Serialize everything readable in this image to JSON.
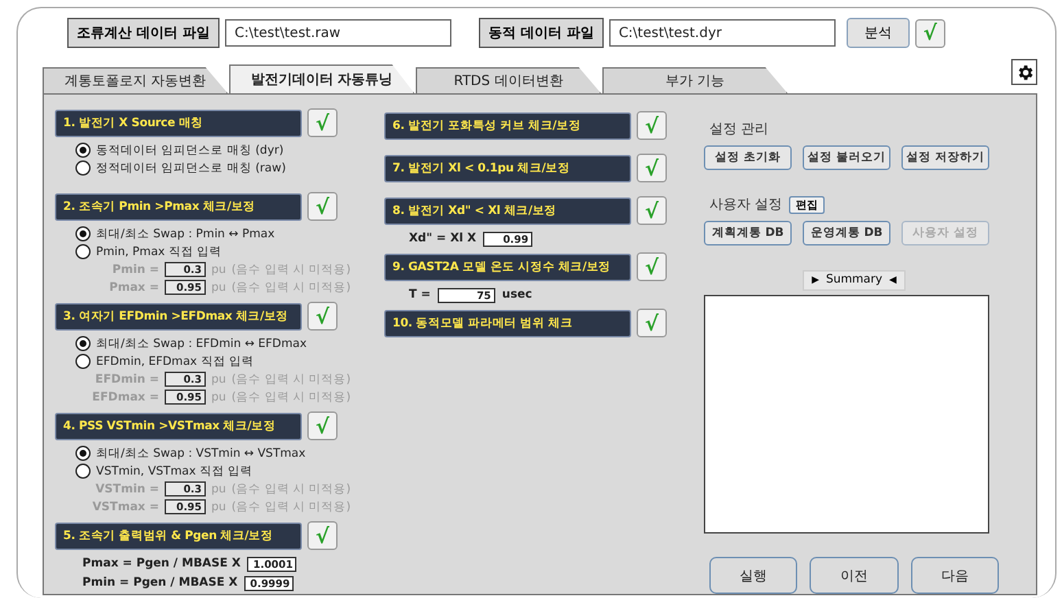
{
  "top_bar": {
    "flow_label": "조류계산 데이터 파일",
    "flow_path": "C:\\test\\test.raw",
    "dyn_label": "동적 데이터 파일",
    "dyn_path": "C:\\test\\test.dyr",
    "analyze_button": "분석",
    "check": "√"
  },
  "tabs": [
    {
      "label": "계통토폴로지 자동변환",
      "selected": false
    },
    {
      "label": "발전기데이터 자동튜닝",
      "selected": true
    },
    {
      "label": "RTDS 데이터변환",
      "selected": false
    },
    {
      "label": "부가 기능",
      "selected": false
    }
  ],
  "left_sections": [
    {
      "title": "1. 발전기 X Source 매칭",
      "check": "√",
      "rows": [
        {
          "kind": "radio",
          "label": "동적데이터 임피던스로 매칭 (dyr)",
          "selected": true
        },
        {
          "kind": "radio",
          "label": "정적데이터 임피던스로 매칭 (raw)",
          "selected": false
        }
      ]
    },
    {
      "title": "2. 조속기 Pmin >Pmax 체크/보정",
      "check": "√",
      "rows": [
        {
          "kind": "radio",
          "label": "최대/최소 Swap : Pmin ↔ Pmax",
          "selected": true
        },
        {
          "kind": "radio",
          "label": "Pmin, Pmax 직접 입력",
          "selected": false
        },
        {
          "kind": "param",
          "label": "Pmin =",
          "value": "0.3",
          "unit": "pu",
          "note": "(음수 입력 시 미적용)",
          "disabled": true
        },
        {
          "kind": "param",
          "label": "Pmax =",
          "value": "0.95",
          "unit": "pu",
          "note": "(음수 입력 시 미적용)",
          "disabled": true
        }
      ]
    },
    {
      "title": "3. 여자기 EFDmin >EFDmax 체크/보정",
      "check": "√",
      "rows": [
        {
          "kind": "radio",
          "label": "최대/최소 Swap : EFDmin ↔ EFDmax",
          "selected": true
        },
        {
          "kind": "radio",
          "label": "EFDmin, EFDmax 직접 입력",
          "selected": false
        },
        {
          "kind": "param",
          "label": "EFDmin =",
          "value": "0.3",
          "unit": "pu",
          "note": "(음수 입력 시 미적용)",
          "disabled": true
        },
        {
          "kind": "param",
          "label": "EFDmax =",
          "value": "0.95",
          "unit": "pu",
          "note": "(음수 입력 시 미적용)",
          "disabled": true
        }
      ]
    },
    {
      "title": "4. PSS VSTmin >VSTmax 체크/보정",
      "check": "√",
      "rows": [
        {
          "kind": "radio",
          "label": "최대/최소 Swap : VSTmin ↔ VSTmax",
          "selected": true
        },
        {
          "kind": "radio",
          "label": "VSTmin, VSTmax 직접 입력",
          "selected": false
        },
        {
          "kind": "param",
          "label": "VSTmin =",
          "value": "0.3",
          "unit": "pu",
          "note": "(음수 입력 시 미적용)",
          "disabled": true
        },
        {
          "kind": "param",
          "label": "VSTmax =",
          "value": "0.95",
          "unit": "pu",
          "note": "(음수 입력 시 미적용)",
          "disabled": true
        }
      ]
    },
    {
      "title": "5. 조속기 출력범위 & Pgen 체크/보정",
      "check": "√",
      "rows": [
        {
          "kind": "formula",
          "label": "Pmax = Pgen / MBASE  X",
          "value": "1.0001"
        },
        {
          "kind": "formula",
          "label": "Pmin = Pgen / MBASE  X",
          "value": "0.9999"
        }
      ]
    }
  ],
  "middle_sections": [
    {
      "title": "6. 발전기 포화특성 커브 체크/보정",
      "check": "√"
    },
    {
      "title": "7. 발전기 Xl  < 0.1pu 체크/보정",
      "check": "√"
    },
    {
      "title": "8. 발전기 Xd\"  < Xl 체크/보정",
      "check": "√",
      "rows": [
        {
          "kind": "formula",
          "label": "Xd\" = Xl X",
          "value": "0.99"
        }
      ]
    },
    {
      "title": "9. GAST2A 모델 온도 시정수 체크/보정",
      "check": "√",
      "rows": [
        {
          "kind": "formula",
          "label": "T =",
          "value": "75",
          "unit": "usec"
        }
      ]
    },
    {
      "title": "10. 동적모델 파라메터 범위 체크",
      "check": "√"
    }
  ],
  "settings": {
    "title": "설정 관리",
    "buttons": [
      {
        "label": "설정 초기화",
        "disabled": false
      },
      {
        "label": "설정 불러오기",
        "disabled": false
      },
      {
        "label": "설정 저장하기",
        "disabled": false
      }
    ]
  },
  "user_settings": {
    "title": "사용자 설정",
    "edit_button": "편집",
    "buttons": [
      {
        "label": "계획계통 DB",
        "disabled": false
      },
      {
        "label": "운영계통 DB",
        "disabled": false
      },
      {
        "label": "사용자 설정",
        "disabled": true
      }
    ]
  },
  "summary": {
    "left_arrow": "▶",
    "label": "Summary",
    "right_arrow": "◀"
  },
  "bottom_buttons": [
    "실행",
    "이전",
    "다음"
  ]
}
